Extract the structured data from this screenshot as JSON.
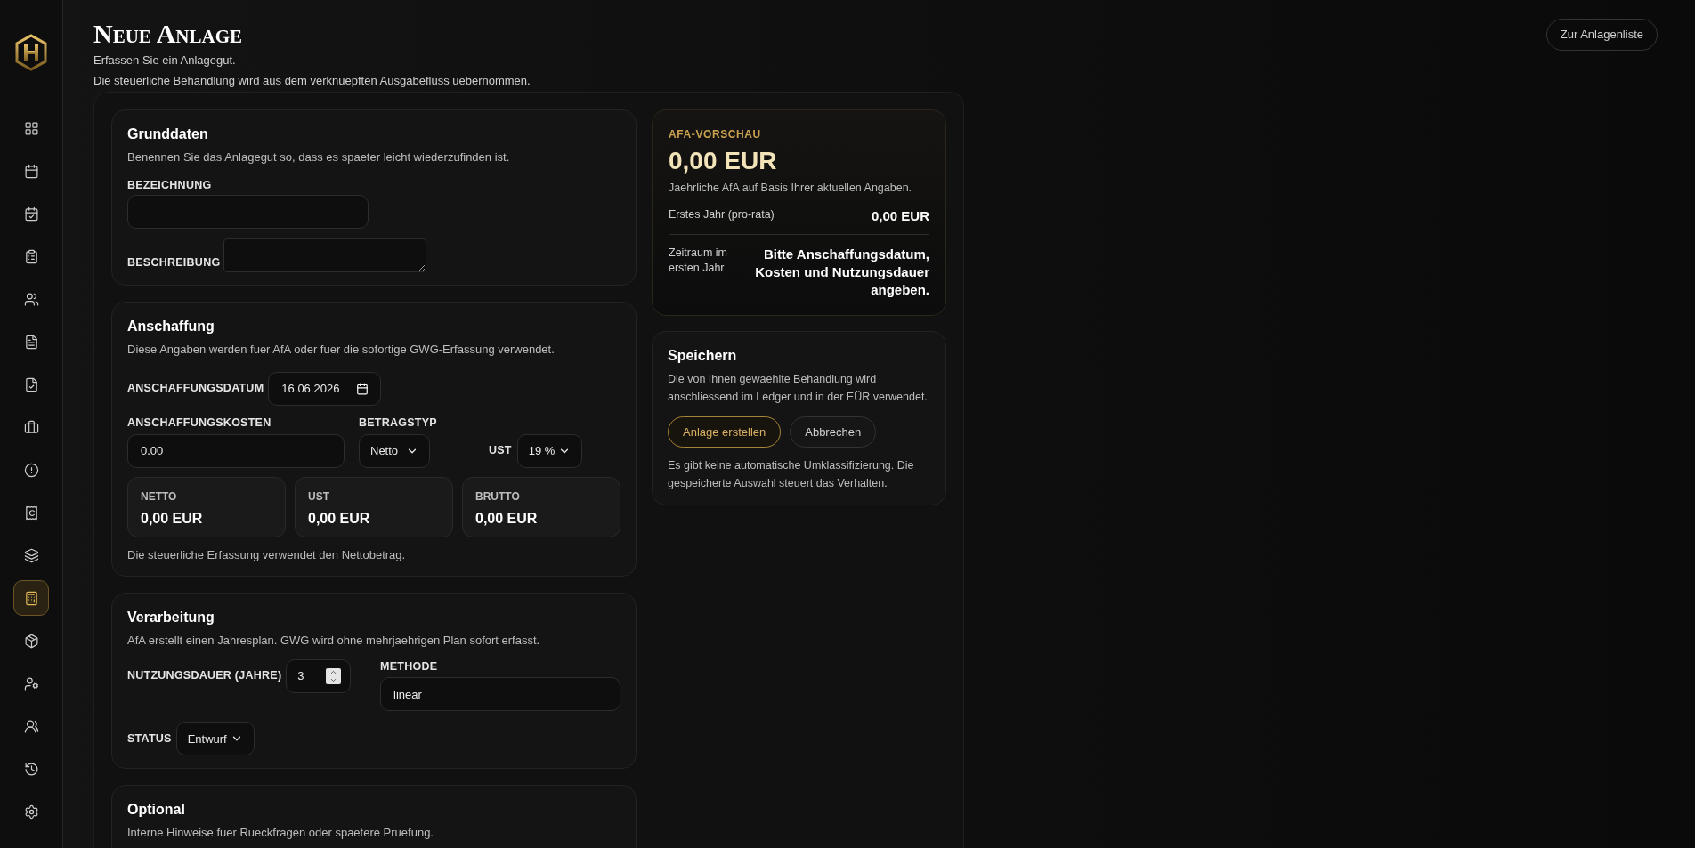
{
  "sidebar": {
    "items": [
      {
        "selected": false
      },
      {
        "selected": false
      },
      {
        "selected": false
      },
      {
        "selected": false
      },
      {
        "selected": false
      },
      {
        "selected": false
      },
      {
        "selected": false
      },
      {
        "selected": false
      },
      {
        "selected": false
      },
      {
        "selected": false
      },
      {
        "selected": false
      },
      {
        "selected": true
      },
      {
        "selected": false
      },
      {
        "selected": false
      },
      {
        "selected": false
      },
      {
        "selected": false
      },
      {
        "selected": false
      }
    ]
  },
  "header": {
    "title": "Neue Anlage",
    "subtitle_lines": [
      "Erfassen Sie ein Anlagegut.",
      "Die steuerliche Behandlung wird aus dem verknuepften Ausgabefluss uebernommen."
    ],
    "back_button": "Zur Anlagenliste"
  },
  "grunddaten": {
    "title": "Grunddaten",
    "hint": "Benennen Sie das Anlagegut so, dass es spaeter leicht wiederzufinden ist.",
    "name_label": "BEZEICHNUNG",
    "description_label": "BESCHREIBUNG"
  },
  "anschaffung": {
    "title": "Anschaffung",
    "hint": "Diese Angaben werden fuer AfA oder fuer die sofortige GWG-Erfassung verwendet.",
    "date": {
      "label": "ANSCHAFFUNGSDATUM",
      "value": "16.06.2026"
    },
    "costs": {
      "label": "ANSCHAFFUNGSKOSTEN",
      "value": "0.00"
    },
    "amount_type": {
      "label": "BETRAGSTYP",
      "value": "Netto"
    },
    "vat": {
      "label": "UST",
      "value": "19 %"
    },
    "totals": [
      {
        "label": "NETTO",
        "value": "0,00 EUR"
      },
      {
        "label": "UST",
        "value": "0,00 EUR"
      },
      {
        "label": "BRUTTO",
        "value": "0,00 EUR"
      }
    ],
    "note": "Die steuerliche Erfassung verwendet den Nettobetrag."
  },
  "verarbeitung": {
    "title": "Verarbeitung",
    "hint": "AfA erstellt einen Jahresplan. GWG wird ohne mehrjaehrigen Plan sofort erfasst.",
    "useful_life": {
      "label": "NUTZUNGSDAUER (JAHRE)",
      "value": "3"
    },
    "method": {
      "label": "METHODE",
      "value": "linear"
    },
    "status": {
      "label": "STATUS",
      "value": "Entwurf"
    }
  },
  "optional": {
    "title": "Optional",
    "hint": "Interne Hinweise fuer Rueckfragen oder spaetere Pruefung."
  },
  "preview": {
    "eyebrow": "AFA-VORSCHAU",
    "amount": "0,00 EUR",
    "hint": "Jaehrliche AfA auf Basis Ihrer aktuellen Angaben.",
    "rows": [
      {
        "label": "Erstes Jahr (pro-rata)",
        "value": "0,00 EUR"
      },
      {
        "label": "Zeitraum im ersten Jahr",
        "value": "Bitte Anschaffungsdatum, Kosten und Nutzungsdauer angeben."
      }
    ]
  },
  "save": {
    "title": "Speichern",
    "hint": "Die von Ihnen gewaehlte Behandlung wird anschliessend im Ledger und in der EÜR verwendet.",
    "buttons": [
      {
        "label": "Anlage erstellen",
        "kind": "primary"
      },
      {
        "label": "Abbrechen",
        "kind": "secondary"
      }
    ],
    "note": "Es gibt keine automatische Umklassifizierung. Die gespeicherte Auswahl steuert das Verhalten."
  }
}
